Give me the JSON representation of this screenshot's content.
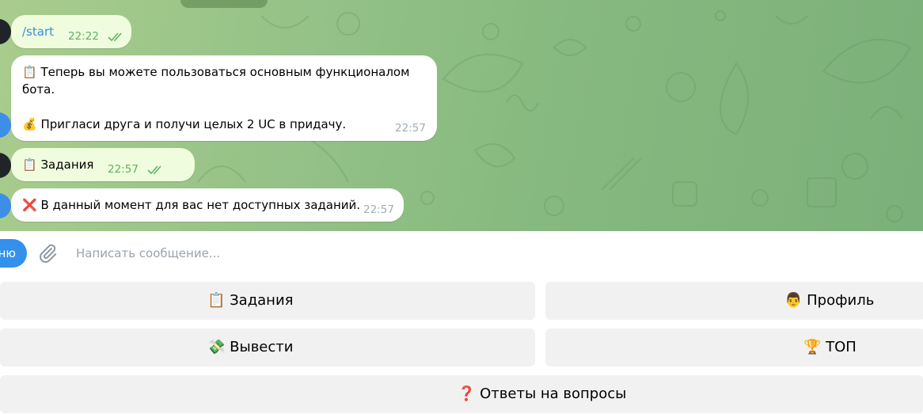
{
  "messages": [
    {
      "text": "/start",
      "time": "22:22",
      "outgoing": true
    },
    {
      "text": "📋 Теперь вы можете пользоваться основным функционалом\nбота.\n\n💰 Пригласи друга и получи целых 2 UC в придачу.",
      "time": "22:57",
      "outgoing": false
    },
    {
      "text": "📋 Задания",
      "time": "22:57",
      "outgoing": true
    },
    {
      "text": "❌ В данный момент для вас нет доступных заданий.",
      "time": "22:57",
      "outgoing": false
    }
  ],
  "composer": {
    "menu_label": "ню",
    "placeholder": "Написать сообщение..."
  },
  "keyboard": {
    "rows": [
      [
        "📋 Задания",
        "👨 Профиль"
      ],
      [
        "💸 Вывести",
        "🏆 ТОП"
      ],
      [
        "❓ Ответы на вопросы"
      ]
    ]
  },
  "icons": {
    "attach": "paperclip-icon",
    "read_status": "double-check-icon"
  },
  "colors": {
    "chat_bg": "#93c187",
    "bubble_in": "#ffffff",
    "bubble_out": "#effdde",
    "accent": "#3390ec",
    "button_bg": "#f1f1f1"
  }
}
